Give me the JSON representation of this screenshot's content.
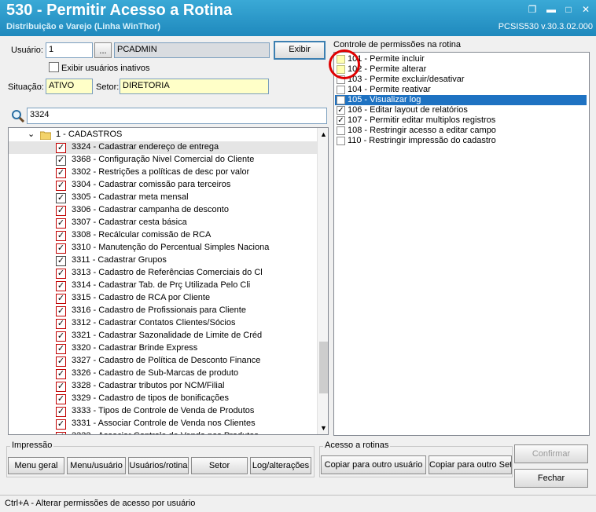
{
  "window": {
    "title": "530 - Permitir Acesso a Rotina",
    "subtitle": "Distribuição e Varejo (Linha WinThor)",
    "version": "PCSIS530  v.30.3.02.000"
  },
  "user_form": {
    "usuario_label": "Usuário:",
    "usuario_value": "1",
    "browse_label": "...",
    "usuario_name": "PCADMIN",
    "exibir_label": "Exibir",
    "inativos_label": "Exibir usuários inativos",
    "situacao_label": "Situação:",
    "situacao_value": "ATIVO",
    "setor_label": "Setor:",
    "setor_value": "DIRETORIA"
  },
  "search": {
    "value": "3324"
  },
  "tree": {
    "folder_label": "1 - CADASTROS",
    "items": [
      {
        "label": "3324 - Cadastrar endereço de entrega"
      },
      {
        "label": "3368 - Configuração Nivel Comercial do Cliente"
      },
      {
        "label": "3302 - Restrições a políticas de desc por valor"
      },
      {
        "label": "3304 - Cadastrar comissão para terceiros"
      },
      {
        "label": "3305 - Cadastrar meta mensal"
      },
      {
        "label": "3306 - Cadastrar campanha de desconto"
      },
      {
        "label": "3307 - Cadastrar cesta básica"
      },
      {
        "label": "3308 - Recálcular comissão de RCA"
      },
      {
        "label": "3310 - Manutenção do Percentual Simples Naciona"
      },
      {
        "label": "3311 - Cadastrar Grupos"
      },
      {
        "label": "3313 - Cadastro de Referências Comerciais do Cl"
      },
      {
        "label": "3314 - Cadastrar Tab. de Prç Utilizada Pelo Cli"
      },
      {
        "label": "3315 - Cadastro de RCA por Cliente"
      },
      {
        "label": "3316 - Cadastro de Profissionais para Cliente"
      },
      {
        "label": "3312 - Cadastrar Contatos Clientes/Sócios"
      },
      {
        "label": "3321 - Cadastrar Sazonalidade de Limite de Créd"
      },
      {
        "label": "3320 - Cadastrar Brinde Express"
      },
      {
        "label": "3327 - Cadastro de Política de Desconto Finance"
      },
      {
        "label": "3326 - Cadastro de Sub-Marcas de produto"
      },
      {
        "label": "3328 - Cadastrar tributos por NCM/Filial"
      },
      {
        "label": "3329 - Cadastro de tipos de bonificações"
      },
      {
        "label": "3333 - Tipos de Controle de Venda de Produtos"
      },
      {
        "label": "3331 - Associar Controle de Venda nos Clientes"
      },
      {
        "label": "3332 - Associar Controle de Venda nos Produtos"
      }
    ]
  },
  "permissions": {
    "title": "Controle de permissões na rotina",
    "items": [
      {
        "label": "101 - Permite incluir",
        "checked": false
      },
      {
        "label": "102 - Permite alterar",
        "checked": false
      },
      {
        "label": "103 - Permite excluir/desativar",
        "checked": false
      },
      {
        "label": "104 - Permite reativar",
        "checked": false
      },
      {
        "label": "105 - Visualizar log",
        "checked": false
      },
      {
        "label": "106 - Editar layout de relatórios",
        "checked": true
      },
      {
        "label": "107 - Permitir editar multiplos registros",
        "checked": true
      },
      {
        "label": "108 - Restringir acesso a editar campo",
        "checked": false
      },
      {
        "label": "110 - Restringir impressão do cadastro",
        "checked": false
      }
    ]
  },
  "impressao": {
    "title": "Impressão",
    "buttons": [
      "Menu geral",
      "Menu/usuário",
      "Usuários/rotina",
      "Setor",
      "Log/alterações"
    ]
  },
  "acesso": {
    "title": "Acesso a rotinas",
    "copy_user": "Copiar para outro usuário",
    "copy_setor": "Copiar para outro Setor"
  },
  "actions": {
    "confirmar": "Confirmar",
    "fechar": "Fechar"
  },
  "status": {
    "text": "Ctrl+A - Alterar permissões de acesso por usuário"
  },
  "colors": {
    "titlebar": "#2a9ccd",
    "selection": "#1e72c2",
    "highlight_circle": "#e00000"
  }
}
